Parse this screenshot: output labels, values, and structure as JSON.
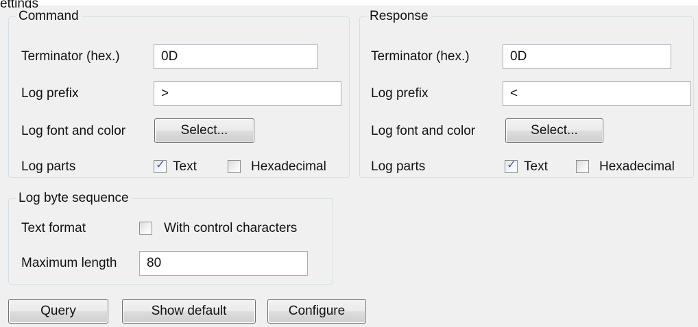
{
  "cut_label": "ettings",
  "command": {
    "title": "Command",
    "terminator_label": "Terminator (hex.)",
    "terminator_value": "0D",
    "log_prefix_label": "Log prefix",
    "log_prefix_value": ">",
    "font_color_label": "Log font and color",
    "select_button": "Select...",
    "log_parts_label": "Log parts",
    "text_checkbox_label": "Text",
    "text_checked": true,
    "hex_checkbox_label": "Hexadecimal",
    "hex_checked": false
  },
  "response": {
    "title": "Response",
    "terminator_label": "Terminator (hex.)",
    "terminator_value": "0D",
    "log_prefix_label": "Log prefix",
    "log_prefix_value": "<",
    "font_color_label": "Log font and color",
    "select_button": "Select...",
    "log_parts_label": "Log parts",
    "text_checkbox_label": "Text",
    "text_checked": true,
    "hex_checkbox_label": "Hexadecimal",
    "hex_checked": false
  },
  "byte_sequence": {
    "title": "Log byte sequence",
    "text_format_label": "Text format",
    "control_chars_label": "With control characters",
    "control_chars_checked": false,
    "max_length_label": "Maximum length",
    "max_length_value": "80"
  },
  "buttons": {
    "query": "Query",
    "show_default": "Show default",
    "configure": "Configure"
  },
  "colors": {
    "panel_bg": "#f0f0f0",
    "group_border": "#d5dfe5",
    "check_mark": "#4a5f97"
  }
}
